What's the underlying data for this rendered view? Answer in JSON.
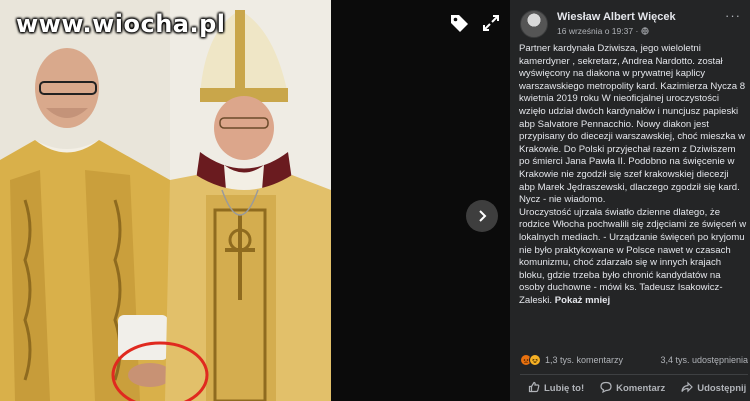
{
  "viewer": {
    "watermark": "www.wiocha.pl",
    "tag_icon": "tag-icon",
    "expand_icon": "expand-icon",
    "next_icon": "chevron-right-icon"
  },
  "post": {
    "author": "Wiesław Albert Więcek",
    "time": "16 września o 19:37 · ",
    "privacy_icon": "globe-icon",
    "more_icon": "more-icon",
    "paragraphs": [
      "Partner kardynała Dziwisza, jego wieloletni kamerdyner , sekretarz, Andrea Nardotto. został wyświęcony na diakona w prywatnej kaplicy warszawskiego metropolity kard. Kazimierza Nycza 8 kwietnia 2019 roku W nieoficjalnej uroczystości wzięło udział dwóch kardynałów i nuncjusz papieski abp Salvatore Pennacchio. Nowy diakon jest przypisany do diecezji warszawskiej, choć mieszka w Krakowie. Do Polski przyjechał razem z Dziwiszem po śmierci Jana Pawła II. Podobno na święcenie w Krakowie nie zgodził się szef krakowskiej diecezji abp Marek Jędraszewski, dlaczego zgodził się kard. Nycz - nie wiadomo.",
      "Uroczystość ujrzała światło dzienne dlatego, że rodzice Włocha pochwalili się zdjęciami ze święceń w lokalnych mediach. - Urządzanie święceń po kryjomu nie było praktykowane w Polsce nawet w czasach komunizmu, choć zdarzało się w innych krajach bloku, gdzie trzeba było chronić kandydatów na osoby duchowne - mówi ks. Tadeusz Isakowicz-Zaleski. "
    ],
    "show_more": "Pokaż mniej",
    "reaction_icons": [
      "angry-icon",
      "haha-icon"
    ],
    "comments": "1,3 tys. komentarzy",
    "shares": "3,4 tys. udostępnienia",
    "actions": {
      "like": "Lubię to!",
      "comment": "Komentarz",
      "share": "Udostępnij"
    }
  },
  "colors": {
    "panel_bg": "#242526",
    "text": "#e4e6eb",
    "muted": "#b0b3b8",
    "annotation_circle": "#e0291f"
  }
}
